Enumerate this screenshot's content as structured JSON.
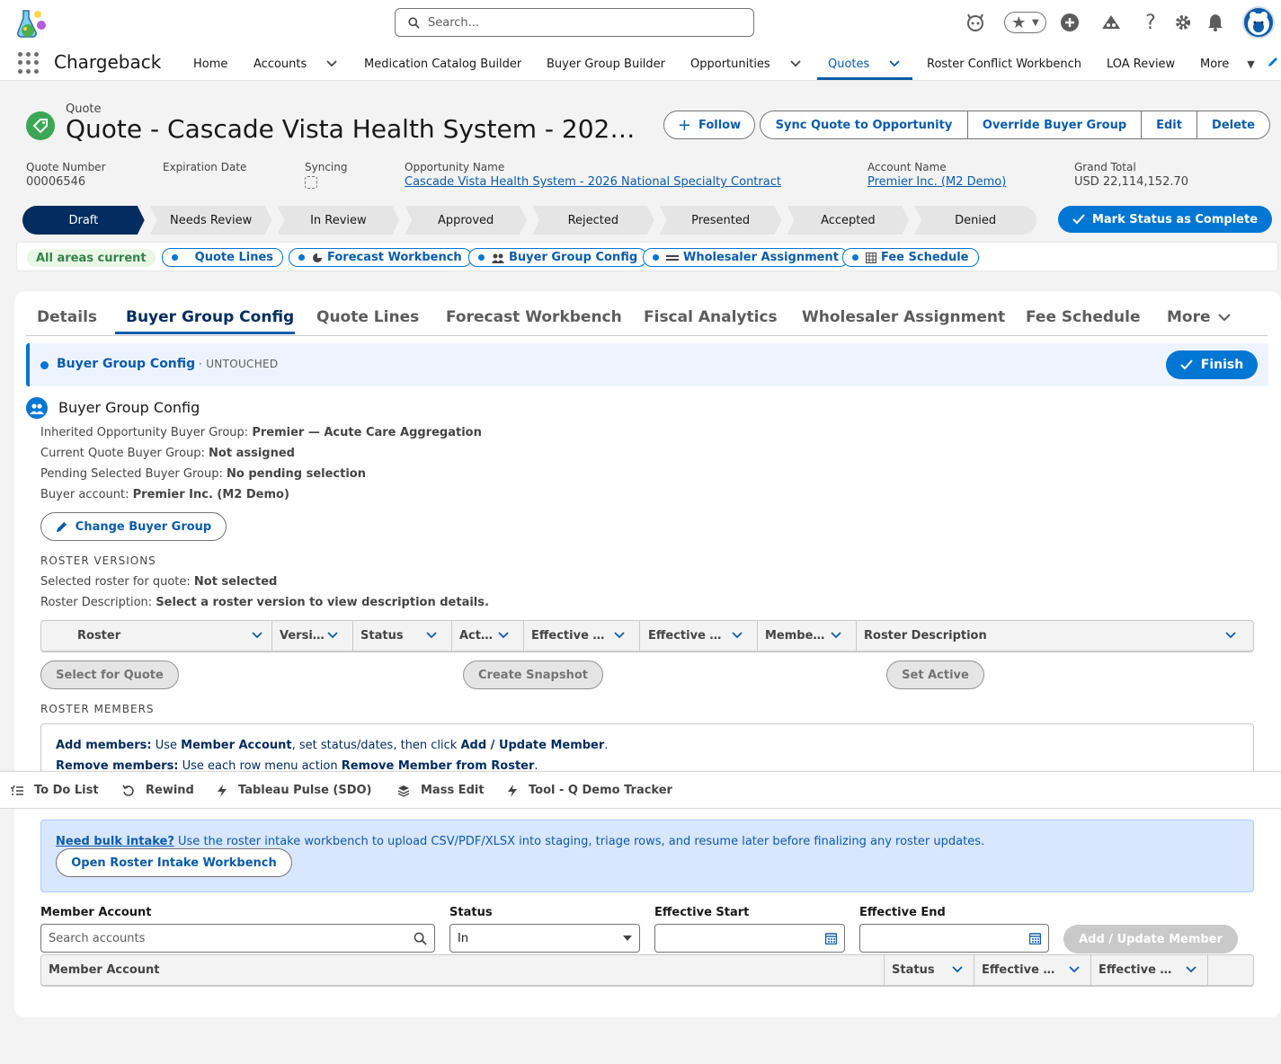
{
  "header": {
    "search_placeholder": "Search...",
    "app_name": "Chargeback"
  },
  "nav": {
    "items": [
      "Home",
      "Accounts",
      "Medication Catalog Builder",
      "Buyer Group Builder",
      "Opportunities",
      "Quotes",
      "Roster Conflict Workbench",
      "LOA Review",
      "More"
    ],
    "active": "Quotes"
  },
  "record": {
    "type_label": "Quote",
    "title": "Quote - Cascade Vista Health System - 202…",
    "actions": {
      "follow": "Follow",
      "sync": "Sync Quote to Opportunity",
      "override": "Override Buyer Group",
      "edit": "Edit",
      "delete": "Delete"
    },
    "fields": {
      "quote_number_label": "Quote Number",
      "quote_number": "00006546",
      "expiration_label": "Expiration Date",
      "syncing_label": "Syncing",
      "opportunity_label": "Opportunity Name",
      "opportunity": "Cascade Vista Health System - 2026 National Specialty Contract",
      "account_label": "Account Name",
      "account": "Premier Inc. (M2 Demo)",
      "total_label": "Grand Total",
      "total": "USD 22,114,152.70"
    }
  },
  "path": {
    "stages": [
      "Draft",
      "Needs Review",
      "In Review",
      "Approved",
      "Rejected",
      "Presented",
      "Accepted",
      "Denied"
    ],
    "current": "Draft",
    "mark_complete": "Mark Status as Complete"
  },
  "areas": {
    "status": "All areas current",
    "chips": [
      "Quote Lines",
      "Forecast Workbench",
      "Buyer Group Config",
      "Wholesaler Assignment",
      "Fee Schedule"
    ]
  },
  "tabs": {
    "items": [
      "Details",
      "Buyer Group Config",
      "Quote Lines",
      "Forecast Workbench",
      "Fiscal Analytics",
      "Wholesaler Assignment",
      "Fee Schedule",
      "More"
    ],
    "active": "Buyer Group Config"
  },
  "banner": {
    "title": "Buyer Group Config",
    "status": "· UNTOUCHED",
    "finish": "Finish"
  },
  "buyer_group": {
    "title": "Buyer Group Config",
    "inherited_label": "Inherited Opportunity Buyer Group:",
    "inherited_value": "Premier — Acute Care Aggregation",
    "current_label": "Current Quote Buyer Group:",
    "current_value": "Not assigned",
    "pending_label": "Pending Selected Buyer Group:",
    "pending_value": "No pending selection",
    "buyer_label": "Buyer account:",
    "buyer_value": "Premier Inc. (M2 Demo)",
    "change_button": "Change Buyer Group"
  },
  "roster_versions": {
    "heading": "ROSTER VERSIONS",
    "selected_label": "Selected roster for quote:",
    "selected_value": "Not selected",
    "desc_label": "Roster Description:",
    "desc_value": "Select a roster version to view description details.",
    "columns": [
      "Roster",
      "Versi…",
      "Status",
      "Act…",
      "Effective …",
      "Effective …",
      "Membe…",
      "Roster Description"
    ],
    "buttons": {
      "select": "Select for Quote",
      "snapshot": "Create Snapshot",
      "active": "Set Active"
    }
  },
  "roster_members": {
    "heading": "ROSTER MEMBERS",
    "add_1": "Add members:",
    "add_2": " Use ",
    "add_3": "Member Account",
    "add_4": ", set status/dates, then click ",
    "add_5": "Add / Update Member",
    "add_6": ".",
    "rem_1": "Remove members:",
    "rem_2": " Use each row menu action ",
    "rem_3": "Remove Member from Roster",
    "rem_4": "."
  },
  "utility_bar": [
    "To Do List",
    "Rewind",
    "Tableau Pulse (SDO)",
    "Mass Edit",
    "Tool - Q Demo Tracker"
  ],
  "bulk": {
    "link": "Need bulk intake?",
    "text": " Use the roster intake workbench to upload CSV/PDF/XLSX into staging, triage rows, and resume later before finalizing any roster updates.",
    "button": "Open Roster Intake Workbench"
  },
  "member_form": {
    "account_label": "Member Account",
    "account_placeholder": "Search accounts",
    "status_label": "Status",
    "status_value": "In",
    "start_label": "Effective Start",
    "end_label": "Effective End",
    "add_button": "Add / Update Member"
  },
  "member_table": {
    "columns": [
      "Member Account",
      "Status",
      "Effective …",
      "Effective …"
    ]
  },
  "colors": {
    "brand": "#0b5cab",
    "accent": "#0176d3",
    "path_current": "#032d60",
    "success": "#2e844a"
  }
}
